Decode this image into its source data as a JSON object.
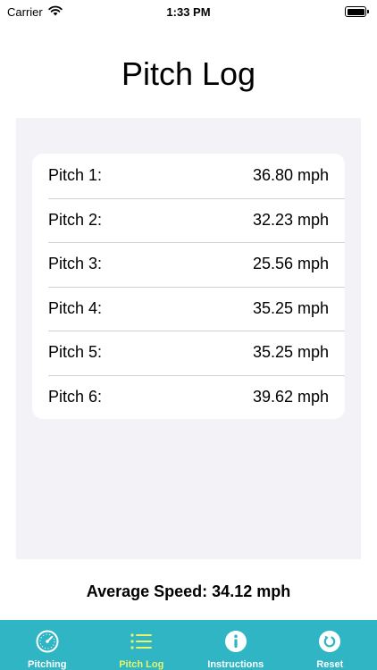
{
  "status_bar": {
    "carrier": "Carrier",
    "time": "1:33 PM"
  },
  "title": "Pitch Log",
  "pitches": [
    {
      "label": "Pitch 1:",
      "speed": "36.80 mph"
    },
    {
      "label": "Pitch 2:",
      "speed": "32.23 mph"
    },
    {
      "label": "Pitch 3:",
      "speed": "25.56 mph"
    },
    {
      "label": "Pitch 4:",
      "speed": "35.25 mph"
    },
    {
      "label": "Pitch 5:",
      "speed": "35.25 mph"
    },
    {
      "label": "Pitch 6:",
      "speed": "39.62 mph"
    }
  ],
  "average": "Average Speed: 34.12 mph",
  "tab_bar": {
    "tabs": [
      {
        "label": "Pitching",
        "icon": "speedometer-icon"
      },
      {
        "label": "Pitch Log",
        "icon": "list-icon",
        "active": true
      },
      {
        "label": "Instructions",
        "icon": "info-icon"
      },
      {
        "label": "Reset",
        "icon": "reset-icon"
      }
    ]
  },
  "colors": {
    "tab_bar_background": "#2fb5c4",
    "tab_active": "#e8f46a",
    "tab_inactive": "#ffffff",
    "panel_background": "#f2f2f7"
  }
}
